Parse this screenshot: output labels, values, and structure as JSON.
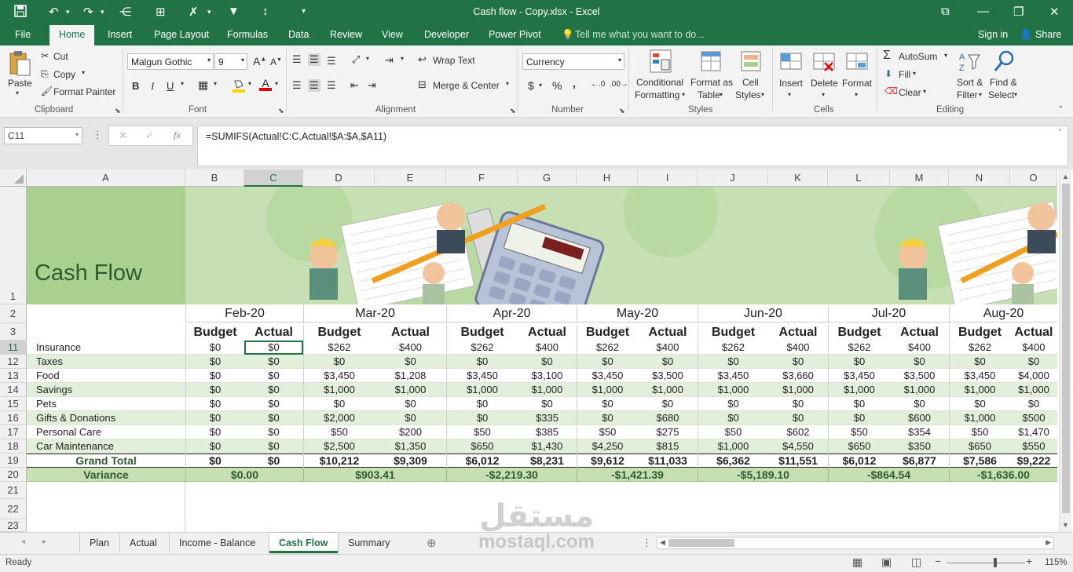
{
  "window": {
    "title": "Cash flow - Copy.xlsx - Excel"
  },
  "menu": {
    "file": "File",
    "home": "Home",
    "insert": "Insert",
    "page_layout": "Page Layout",
    "formulas": "Formulas",
    "data": "Data",
    "review": "Review",
    "view": "View",
    "developer": "Developer",
    "power_pivot": "Power Pivot",
    "tell_me": "Tell me what you want to do...",
    "sign_in": "Sign in",
    "share": "Share"
  },
  "ribbon": {
    "clipboard": {
      "paste": "Paste",
      "cut": "Cut",
      "copy": "Copy",
      "format_painter": "Format Painter",
      "group": "Clipboard"
    },
    "font": {
      "name": "Malgun Gothic",
      "size": "9",
      "bold": "B",
      "italic": "I",
      "underline": "U",
      "group": "Font"
    },
    "alignment": {
      "wrap_text": "Wrap Text",
      "merge_center": "Merge & Center",
      "group": "Alignment"
    },
    "number": {
      "format": "Currency",
      "dollar": "$",
      "percent": "%",
      "comma": ",",
      "group": "Number"
    },
    "styles": {
      "conditional": "Conditional",
      "conditional2": "Formatting",
      "format_as": "Format as",
      "format_as2": "Table",
      "cell": "Cell",
      "cell2": "Styles",
      "group": "Styles"
    },
    "cells": {
      "insert": "Insert",
      "delete": "Delete",
      "format": "Format",
      "group": "Cells"
    },
    "editing": {
      "autosum": "AutoSum",
      "fill": "Fill",
      "clear": "Clear",
      "sort": "Sort &",
      "sort2": "Filter",
      "find": "Find &",
      "find2": "Select",
      "group": "Editing"
    }
  },
  "formula": {
    "name_box": "C11",
    "fx": "fx",
    "content": "=SUMIFS(Actual!C:C,Actual!$A:$A,$A11)"
  },
  "columns": [
    "A",
    "B",
    "C",
    "D",
    "E",
    "F",
    "G",
    "H",
    "I",
    "J",
    "K",
    "L",
    "M",
    "N",
    "O"
  ],
  "rows": [
    "1",
    "2",
    "3",
    "11",
    "12",
    "13",
    "14",
    "15",
    "16",
    "17",
    "18",
    "19",
    "20",
    "21",
    "22",
    "23"
  ],
  "sheet": {
    "title": "Cash Flow",
    "months": [
      "Feb-20",
      "Mar-20",
      "Apr-20",
      "May-20",
      "Jun-20",
      "Jul-20",
      "Aug-20"
    ],
    "budget_label": "Budget",
    "actual_label": "Actual",
    "categories": [
      "Insurance",
      "Taxes",
      "Food",
      "Savings",
      "Pets",
      "Gifts & Donations",
      "Personal Care",
      "Car Maintenance"
    ],
    "values": [
      [
        "$0",
        "$0",
        "$262",
        "$400",
        "$262",
        "$400",
        "$262",
        "$400",
        "$262",
        "$400",
        "$262",
        "$400",
        "$262",
        "$400"
      ],
      [
        "$0",
        "$0",
        "$0",
        "$0",
        "$0",
        "$0",
        "$0",
        "$0",
        "$0",
        "$0",
        "$0",
        "$0",
        "$0",
        "$0"
      ],
      [
        "$0",
        "$0",
        "$3,450",
        "$1,208",
        "$3,450",
        "$3,100",
        "$3,450",
        "$3,500",
        "$3,450",
        "$3,660",
        "$3,450",
        "$3,500",
        "$3,450",
        "$4,000"
      ],
      [
        "$0",
        "$0",
        "$1,000",
        "$1,000",
        "$1,000",
        "$1,000",
        "$1,000",
        "$1,000",
        "$1,000",
        "$1,000",
        "$1,000",
        "$1,000",
        "$1,000",
        "$1,000"
      ],
      [
        "$0",
        "$0",
        "$0",
        "$0",
        "$0",
        "$0",
        "$0",
        "$0",
        "$0",
        "$0",
        "$0",
        "$0",
        "$0",
        "$0"
      ],
      [
        "$0",
        "$0",
        "$2,000",
        "$0",
        "$0",
        "$335",
        "$0",
        "$680",
        "$0",
        "$0",
        "$0",
        "$600",
        "$1,000",
        "$500"
      ],
      [
        "$0",
        "$0",
        "$50",
        "$200",
        "$50",
        "$385",
        "$50",
        "$275",
        "$50",
        "$602",
        "$50",
        "$354",
        "$50",
        "$1,470"
      ],
      [
        "$0",
        "$0",
        "$2,500",
        "$1,350",
        "$650",
        "$1,430",
        "$4,250",
        "$815",
        "$1,000",
        "$4,550",
        "$650",
        "$350",
        "$650",
        "$550"
      ]
    ],
    "grand_total_label": "Grand Total",
    "grand_total": [
      "$0",
      "$0",
      "$10,212",
      "$9,309",
      "$6,012",
      "$8,231",
      "$9,612",
      "$11,033",
      "$6,362",
      "$11,551",
      "$6,012",
      "$6,877",
      "$7,586",
      "$9,222"
    ],
    "variance_label": "Variance",
    "variance": [
      "$0.00",
      "$903.41",
      "-$2,219.30",
      "-$1,421.39",
      "-$5,189.10",
      "-$864.54",
      "-$1,636.00"
    ]
  },
  "tabs": [
    "Plan",
    "Actual",
    "Income - Balance",
    "Cash Flow",
    "Summary"
  ],
  "active_tab": "Cash Flow",
  "watermark": {
    "arabic": "مستقل",
    "latin": "mostaql.com"
  },
  "status": {
    "ready": "Ready",
    "zoom": "115%",
    "zoom_level": 0.62
  },
  "colors": {
    "excel_green": "#217346",
    "header_green": "#c6e0b4",
    "band_green": "#e2efda",
    "variance_green": "#c6e0b4"
  }
}
